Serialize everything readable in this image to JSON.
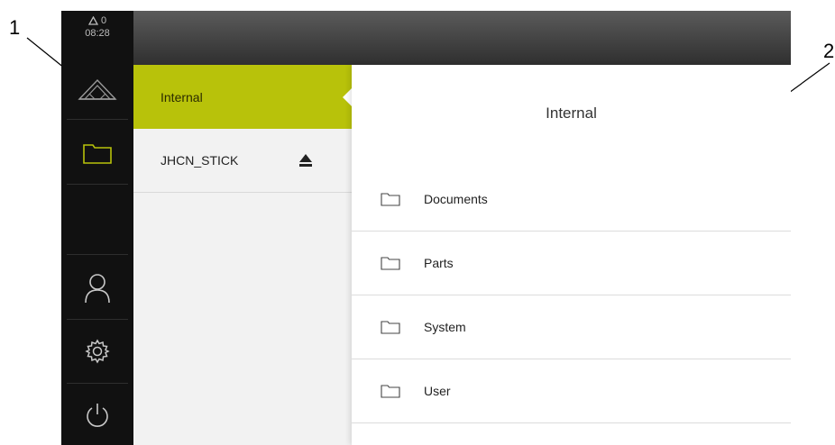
{
  "callouts": {
    "one": "1",
    "two": "2"
  },
  "status": {
    "warning_count": "0",
    "time": "08:28"
  },
  "main_menu": [
    {
      "name": "measure-icon",
      "active": false
    },
    {
      "name": "folder-icon",
      "active": true
    },
    {
      "name": "user-icon",
      "active": false
    },
    {
      "name": "gear-icon",
      "active": false
    },
    {
      "name": "power-icon",
      "active": false
    }
  ],
  "storage": {
    "items": [
      {
        "label": "Internal",
        "selected": true
      },
      {
        "label": "JHCN_STICK",
        "selected": false,
        "eject_icon": "eject-icon"
      }
    ]
  },
  "content": {
    "title": "Internal",
    "folders": [
      {
        "label": "Documents",
        "icon": "folder-icon"
      },
      {
        "label": "Parts",
        "icon": "folder-icon"
      },
      {
        "label": "System",
        "icon": "folder-icon"
      },
      {
        "label": "User",
        "icon": "folder-icon"
      }
    ]
  },
  "colors": {
    "accent": "#b8c20a",
    "sidebar": "#111111",
    "active_icon": "#b8c20a"
  }
}
